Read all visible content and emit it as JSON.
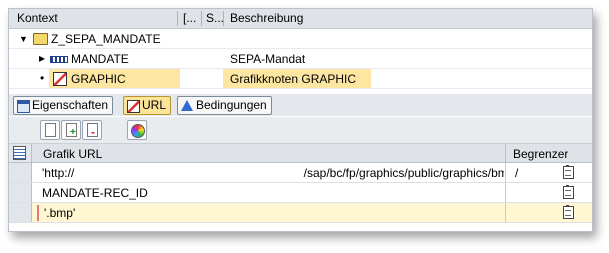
{
  "context_tree": {
    "header": {
      "kontext": "Kontext",
      "col2": "[...",
      "col3": "S...",
      "beschreibung": "Beschreibung"
    },
    "rows": [
      {
        "name": "Z_SEPA_MANDATE",
        "description": ""
      },
      {
        "name": "MANDATE",
        "description": "SEPA-Mandat"
      },
      {
        "name": "GRAPHIC",
        "description": "Grafikknoten GRAPHIC"
      }
    ]
  },
  "tabs": [
    {
      "label": "Eigenschaften"
    },
    {
      "label": "URL"
    },
    {
      "label": "Bedingungen"
    }
  ],
  "table": {
    "columns": {
      "url": "Grafik URL",
      "limiter": "Begrenzer"
    },
    "rows": [
      {
        "url_prefix": "'http://",
        "url_highlight": "/sap/bc/fp/graphics/public/graphics/bmap/bcol'",
        "limiter": "/"
      },
      {
        "url": "MANDATE-REC_ID",
        "limiter": ""
      },
      {
        "url": "'.bmp'",
        "limiter": ""
      }
    ]
  },
  "colors": {
    "selection": "#fde6a2",
    "highlight": "#f0f53a",
    "active_tab": "#fde39a"
  }
}
